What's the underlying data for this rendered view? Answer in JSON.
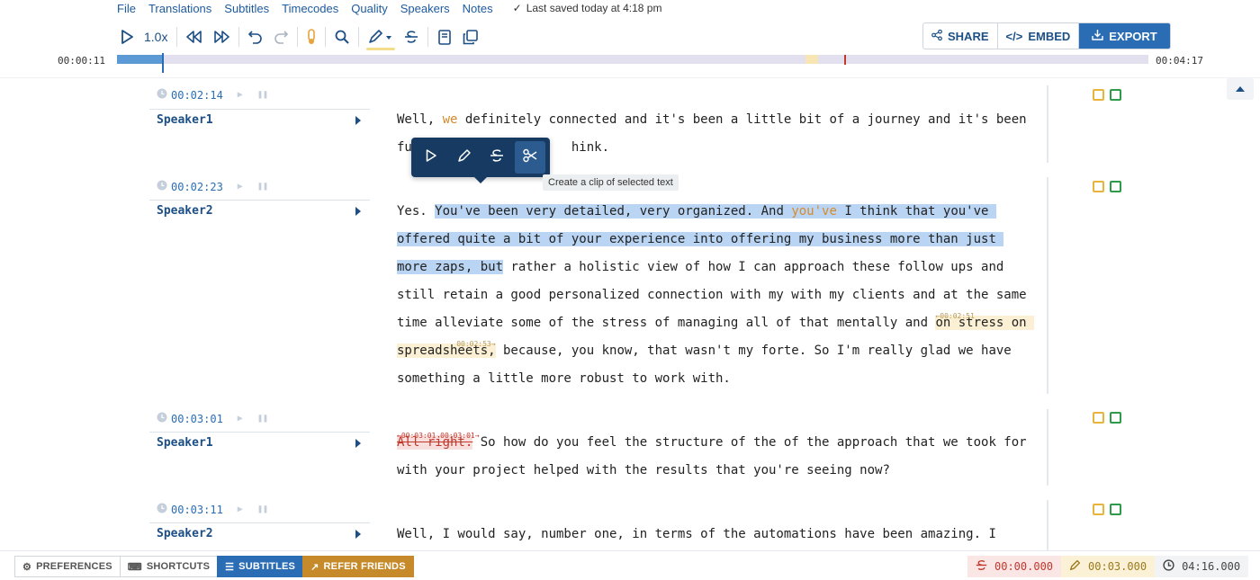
{
  "menu": {
    "items": [
      "File",
      "Translations",
      "Subtitles",
      "Timecodes",
      "Quality",
      "Speakers",
      "Notes"
    ],
    "saved_status": "Last saved today at 4:18 pm"
  },
  "toolbar": {
    "speed": "1.0x"
  },
  "share_group": {
    "share_label": "SHARE",
    "embed_label": "EMBED",
    "export_label": "EXPORT"
  },
  "timeline": {
    "current_time": "00:00:11",
    "total_time": "00:04:17",
    "progress_fraction": 0.044
  },
  "floating_toolbar": {
    "tooltip": "Create a clip of selected text"
  },
  "blocks": [
    {
      "timestamp": "00:02:14",
      "speaker": "Speaker1",
      "lines": [
        [
          {
            "t": "Well, "
          },
          {
            "t": "we",
            "c": "orange"
          },
          {
            "t": " definitely connected and it's been a little bit of a journey and it's been"
          }
        ],
        [
          {
            "t": "fu"
          },
          {
            "t": "                     "
          },
          {
            "t": "hink."
          }
        ]
      ]
    },
    {
      "timestamp": "00:02:23",
      "speaker": "Speaker2",
      "lines": [
        [
          {
            "t": "Yes. "
          },
          {
            "t": "You've been very detailed, very organized. And ",
            "c": "sel"
          },
          {
            "t": "you've",
            "c": "sel orange"
          },
          {
            "t": " I think that you've ",
            "c": "sel"
          }
        ],
        [
          {
            "t": "offered quite a bit of your experience into offering my business more than just ",
            "c": "sel"
          }
        ],
        [
          {
            "t": "more zaps, but",
            "c": "sel"
          },
          {
            "t": " rather a holistic view of how I can approach these follow ups and"
          }
        ],
        [
          {
            "t": "still retain a good personalized connection with my with my clients and at the same"
          }
        ],
        [
          {
            "t": "time alleviate some of the stress of managing all of that mentally and "
          },
          {
            "t": "on stress on ",
            "c": "hl",
            "tag": "←00:02:51"
          }
        ],
        [
          {
            "t": "spreadsheets,",
            "c": "hl",
            "tag": "00:02:53→"
          },
          {
            "t": " because, you know, that wasn't my forte. So I'm really glad we have"
          }
        ],
        [
          {
            "t": "something a little more robust to work with."
          }
        ]
      ]
    },
    {
      "timestamp": "00:03:01",
      "speaker": "Speaker1",
      "lines": [
        [
          {
            "t": "All right.",
            "c": "strike",
            "tag": "←00:03:01 00:03:01→"
          },
          {
            "t": " So how do you feel the structure of the of the approach that we took for"
          }
        ],
        [
          {
            "t": "with your project helped with the results that you're seeing now?"
          }
        ]
      ]
    },
    {
      "timestamp": "00:03:11",
      "speaker": "Speaker2",
      "lines": [
        [
          {
            "t": "Well, I would say, number one, in terms of the automations have been amazing. I"
          }
        ]
      ]
    }
  ],
  "bottombar": {
    "preferences_label": "PREFERENCES",
    "shortcuts_label": "SHORTCUTS",
    "subtitles_label": "SUBTITLES",
    "refer_label": "REFER FRIENDS",
    "strike_time": "00:00.000",
    "edit_time": "00:03.000",
    "duration": "04:16.000"
  },
  "colors": {
    "accent": "#2a6db5",
    "selection": "#b9d5f3",
    "highlight": "#fbf0d3",
    "strike": "#c0392b",
    "refer": "#c78a2a"
  }
}
